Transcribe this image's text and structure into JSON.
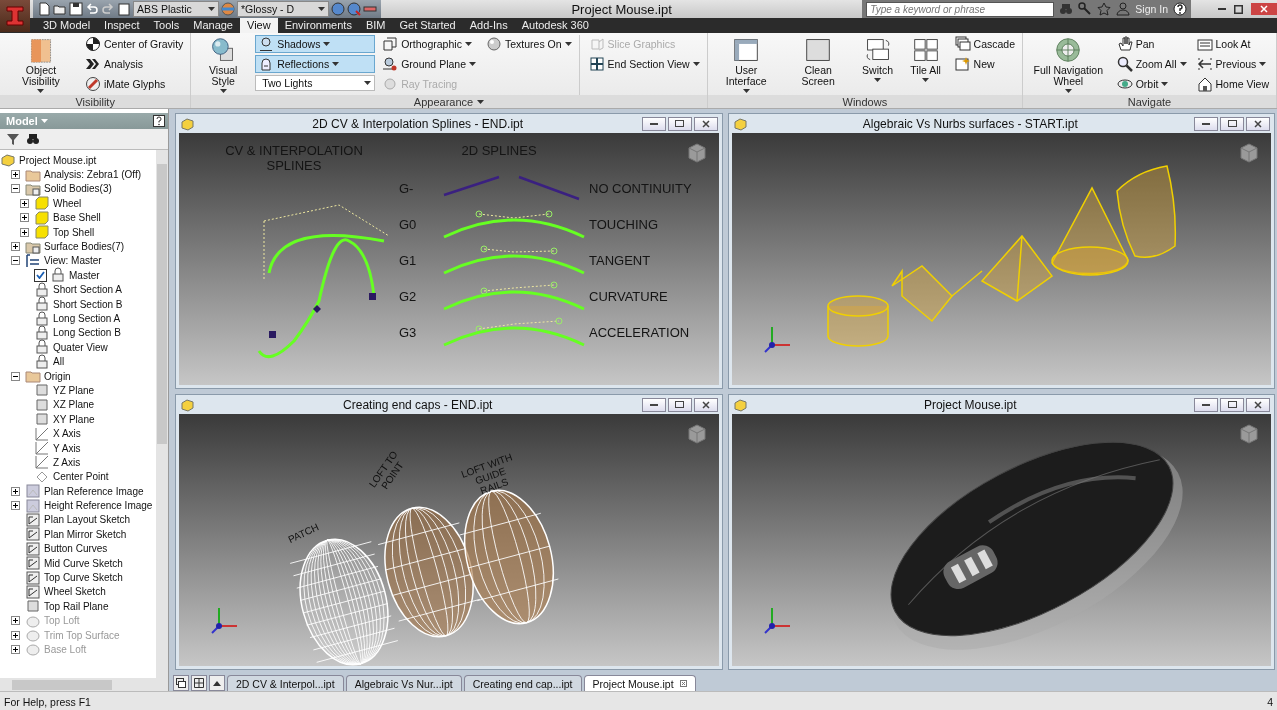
{
  "title_bar": {
    "material": "ABS Plastic",
    "appearance": "*Glossy - D",
    "title": "Project Mouse.ipt",
    "search": {
      "placeholder": "Type a keyword or phrase"
    },
    "sign_in": "Sign In"
  },
  "ribbon_tabs": [
    {
      "label": "3D Model",
      "selected": false
    },
    {
      "label": "Inspect",
      "selected": false
    },
    {
      "label": "Tools",
      "selected": false
    },
    {
      "label": "Manage",
      "selected": false
    },
    {
      "label": "View",
      "selected": true
    },
    {
      "label": "Environments",
      "selected": false
    },
    {
      "label": "BIM",
      "selected": false
    },
    {
      "label": "Get Started",
      "selected": false
    },
    {
      "label": "Add-Ins",
      "selected": false
    },
    {
      "label": "Autodesk 360",
      "selected": false
    }
  ],
  "ribbon_panels": [
    {
      "title": "Visibility",
      "menu": false,
      "columns": [
        [
          {
            "label": "Object Visibility",
            "kind": "large",
            "dropdown": true,
            "on": false,
            "disabled": false
          }
        ],
        [
          {
            "label": "Center of Gravity",
            "kind": "small",
            "dropdown": false,
            "on": false,
            "disabled": false
          },
          {
            "label": "Analysis",
            "kind": "small",
            "dropdown": false,
            "on": false,
            "disabled": false
          },
          {
            "label": "iMate Glyphs",
            "kind": "small",
            "dropdown": false,
            "on": false,
            "disabled": false
          }
        ]
      ]
    },
    {
      "title": "Appearance",
      "menu": true,
      "columns": [
        [
          {
            "label": "Visual Style",
            "kind": "large",
            "dropdown": true,
            "on": false,
            "disabled": false
          }
        ],
        [
          {
            "label": "Shadows",
            "kind": "split",
            "dropdown": true,
            "on": true,
            "disabled": false
          },
          {
            "label": "Reflections",
            "kind": "split",
            "dropdown": true,
            "on": true,
            "disabled": false
          },
          {
            "label": "Two Lights",
            "kind": "combo",
            "dropdown": true,
            "on": false,
            "disabled": false
          }
        ],
        [
          {
            "label": "Orthographic",
            "kind": "small",
            "dropdown": true,
            "on": false,
            "disabled": false
          },
          {
            "label": "Ground Plane",
            "kind": "small",
            "dropdown": true,
            "on": false,
            "disabled": false
          },
          {
            "label": "Ray Tracing",
            "kind": "small",
            "dropdown": false,
            "on": false,
            "disabled": true
          }
        ],
        [
          {
            "label": "Textures On",
            "kind": "small",
            "dropdown": true,
            "on": false,
            "disabled": false
          }
        ],
        [
          {
            "label": "Slice Graphics",
            "kind": "small",
            "dropdown": false,
            "on": false,
            "disabled": true
          },
          {
            "label": "End Section View",
            "kind": "small",
            "dropdown": true,
            "on": false,
            "disabled": false
          }
        ]
      ]
    },
    {
      "title": "Windows",
      "menu": false,
      "columns": [
        [
          {
            "label": "User Interface",
            "kind": "large",
            "dropdown": true,
            "on": false,
            "disabled": false
          }
        ],
        [
          {
            "label": "Clean Screen",
            "kind": "large",
            "dropdown": false,
            "on": false,
            "disabled": false
          }
        ],
        [
          {
            "label": "Switch",
            "kind": "large",
            "dropdown": true,
            "on": false,
            "disabled": false
          }
        ],
        [
          {
            "label": "Tile All",
            "kind": "large",
            "dropdown": true,
            "on": false,
            "disabled": false
          }
        ],
        [
          {
            "label": "Cascade",
            "kind": "small",
            "dropdown": false,
            "on": false,
            "disabled": false
          },
          {
            "label": "New",
            "kind": "small",
            "dropdown": false,
            "on": false,
            "disabled": false
          }
        ]
      ]
    },
    {
      "title": "Navigate",
      "menu": false,
      "columns": [
        [
          {
            "label": "Full Navigation Wheel",
            "kind": "large",
            "dropdown": true,
            "on": false,
            "disabled": false
          }
        ],
        [
          {
            "label": "Pan",
            "kind": "small",
            "dropdown": false,
            "on": false,
            "disabled": false
          },
          {
            "label": "Zoom All",
            "kind": "small",
            "dropdown": true,
            "on": false,
            "disabled": false
          },
          {
            "label": "Orbit",
            "kind": "small",
            "dropdown": true,
            "on": false,
            "disabled": false
          }
        ],
        [
          {
            "label": "Look At",
            "kind": "small",
            "dropdown": false,
            "on": false,
            "disabled": false
          },
          {
            "label": "Previous",
            "kind": "small",
            "dropdown": true,
            "on": false,
            "disabled": false
          },
          {
            "label": "Home View",
            "kind": "small",
            "dropdown": false,
            "on": false,
            "disabled": false
          }
        ]
      ]
    }
  ],
  "browser": {
    "title": "Model",
    "tree": [
      {
        "label": "Project Mouse.ipt",
        "kind": "part",
        "children": [
          {
            "label": "Analysis: Zebra1 (Off)",
            "kind": "folder",
            "expanded": false,
            "disabled": false
          },
          {
            "label": "Solid Bodies(3)",
            "kind": "bodies",
            "expanded": true,
            "disabled": false,
            "children": [
              {
                "label": "Wheel",
                "kind": "body",
                "expanded": false
              },
              {
                "label": "Base Shell",
                "kind": "body",
                "expanded": false
              },
              {
                "label": "Top Shell",
                "kind": "body",
                "expanded": false
              }
            ]
          },
          {
            "label": "Surface Bodies(7)",
            "kind": "bodies",
            "expanded": false,
            "disabled": false
          },
          {
            "label": "View: Master",
            "kind": "view",
            "expanded": true,
            "disabled": false,
            "children": [
              {
                "label": "Master",
                "kind": "lock",
                "checked": true
              },
              {
                "label": "Short Section A",
                "kind": "lock",
                "checked": false
              },
              {
                "label": "Short Section B",
                "kind": "lock",
                "checked": false
              },
              {
                "label": "Long Section A",
                "kind": "lock",
                "checked": false
              },
              {
                "label": "Long Section B",
                "kind": "lock",
                "checked": false
              },
              {
                "label": "Quater View",
                "kind": "lock",
                "checked": false
              },
              {
                "label": "All",
                "kind": "lock",
                "checked": false
              }
            ]
          },
          {
            "label": "Origin",
            "kind": "folder",
            "expanded": true,
            "disabled": false,
            "children": [
              {
                "label": "YZ Plane",
                "kind": "plane"
              },
              {
                "label": "XZ Plane",
                "kind": "plane"
              },
              {
                "label": "XY Plane",
                "kind": "plane"
              },
              {
                "label": "X Axis",
                "kind": "axis"
              },
              {
                "label": "Y Axis",
                "kind": "axis"
              },
              {
                "label": "Z Axis",
                "kind": "axis"
              },
              {
                "label": "Center Point",
                "kind": "point"
              }
            ]
          },
          {
            "label": "Plan Reference Image",
            "kind": "image",
            "expanded": false,
            "disabled": false
          },
          {
            "label": "Height Reference Image",
            "kind": "image",
            "expanded": false,
            "disabled": false
          },
          {
            "label": "Plan Layout Sketch",
            "kind": "sketch",
            "disabled": false
          },
          {
            "label": "Plan Mirror Sketch",
            "kind": "sketch",
            "disabled": false
          },
          {
            "label": "Button Curves",
            "kind": "sketch",
            "disabled": false
          },
          {
            "label": "Mid Curve Sketch",
            "kind": "sketch",
            "disabled": false
          },
          {
            "label": "Top Curve Sketch",
            "kind": "sketch",
            "disabled": false
          },
          {
            "label": "Wheel Sketch",
            "kind": "sketch",
            "disabled": false
          },
          {
            "label": "Top Rail Plane",
            "kind": "plane",
            "disabled": false
          },
          {
            "label": "Top Loft",
            "kind": "feature",
            "expanded": false,
            "disabled": true
          },
          {
            "label": "Trim Top Surface",
            "kind": "feature",
            "expanded": false,
            "disabled": true
          },
          {
            "label": "Base Loft",
            "kind": "feature",
            "expanded": false,
            "disabled": true
          }
        ]
      }
    ]
  },
  "windows": [
    {
      "title": "2D CV & Interpolation Splines - END.ipt",
      "kind": "splines",
      "heading": "CV & INTERPOLATION SPLINES",
      "splines_heading": "2D SPLINES",
      "rows": [
        {
          "grade": "G-",
          "name": "NO CONTINUITY",
          "kind": "broken"
        },
        {
          "grade": "G0",
          "name": "TOUCHING",
          "kind": "smooth"
        },
        {
          "grade": "G1",
          "name": "TANGENT",
          "kind": "smooth"
        },
        {
          "grade": "G2",
          "name": "CURVATURE",
          "kind": "smooth"
        },
        {
          "grade": "G3",
          "name": "ACCELERATION",
          "kind": "smooth"
        }
      ]
    },
    {
      "title": "Algebraic Vs Nurbs surfaces - START.ipt",
      "kind": "surfaces"
    },
    {
      "title": "Creating end caps - END.ipt",
      "kind": "caps",
      "labels": [
        "PATCH",
        "LOFT TO POINT",
        "LOFT WITH GUIDE RAILS"
      ]
    },
    {
      "title": "Project Mouse.ipt",
      "kind": "mouse"
    }
  ],
  "document_tabs": [
    {
      "label": "2D CV & Interpol...ipt",
      "selected": false
    },
    {
      "label": "Algebraic Vs Nur...ipt",
      "selected": false
    },
    {
      "label": "Creating end cap...ipt",
      "selected": false
    },
    {
      "label": "Project Mouse.ipt",
      "selected": true
    }
  ],
  "status_bar": {
    "help": "For Help, press F1",
    "count": "4"
  }
}
